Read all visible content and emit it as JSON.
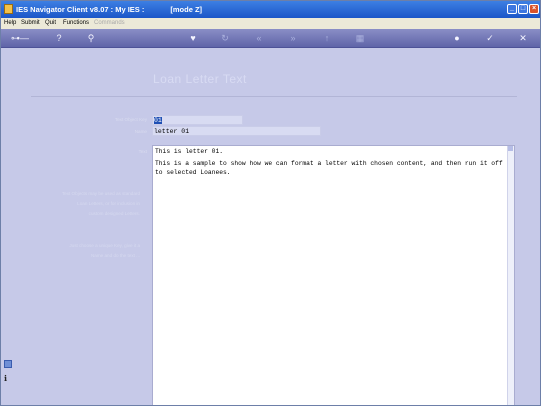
{
  "window": {
    "app_title": "IES Navigator Client v8.07 : My IES :",
    "mode": "[mode Z]"
  },
  "menu": [
    {
      "label": "Help",
      "enabled": true
    },
    {
      "label": "Submit",
      "enabled": true
    },
    {
      "label": "Quit",
      "enabled": true
    },
    {
      "label": "Functions",
      "enabled": true
    },
    {
      "label": "Commands",
      "enabled": false
    }
  ],
  "toolbar_icons": [
    "key-icon",
    "help-circle-icon",
    "search-icon",
    "heart-icon",
    "refresh-icon",
    "rewind-icon",
    "fast-forward-icon",
    "up-arrow-icon",
    "grid-icon",
    "lock-icon",
    "check-icon",
    "close-icon"
  ],
  "form": {
    "heading": "Loan Letter Text",
    "key_label": "Text Object Key",
    "key_value": "01",
    "name_label": "Name",
    "name_value": "letter 01",
    "text_label": "Text",
    "text_lines": [
      "This is letter 01.",
      "",
      "This is a sample to show how we can format a letter with chosen content, and then run it off",
      "to selected Loanees."
    ]
  },
  "help_text": {
    "para1": [
      "Text Objects may be used as standard",
      "Loan Letters, or for inclusion in",
      "custom designed Letters."
    ],
    "para2": [
      "Just choose a unique Key, give it a",
      "Name and do the text ..."
    ]
  },
  "colors": {
    "titlebar": "#1b56c8",
    "background": "#c6c9e8",
    "toolbar": "#6c71b2",
    "selection": "#1f4fb4"
  }
}
